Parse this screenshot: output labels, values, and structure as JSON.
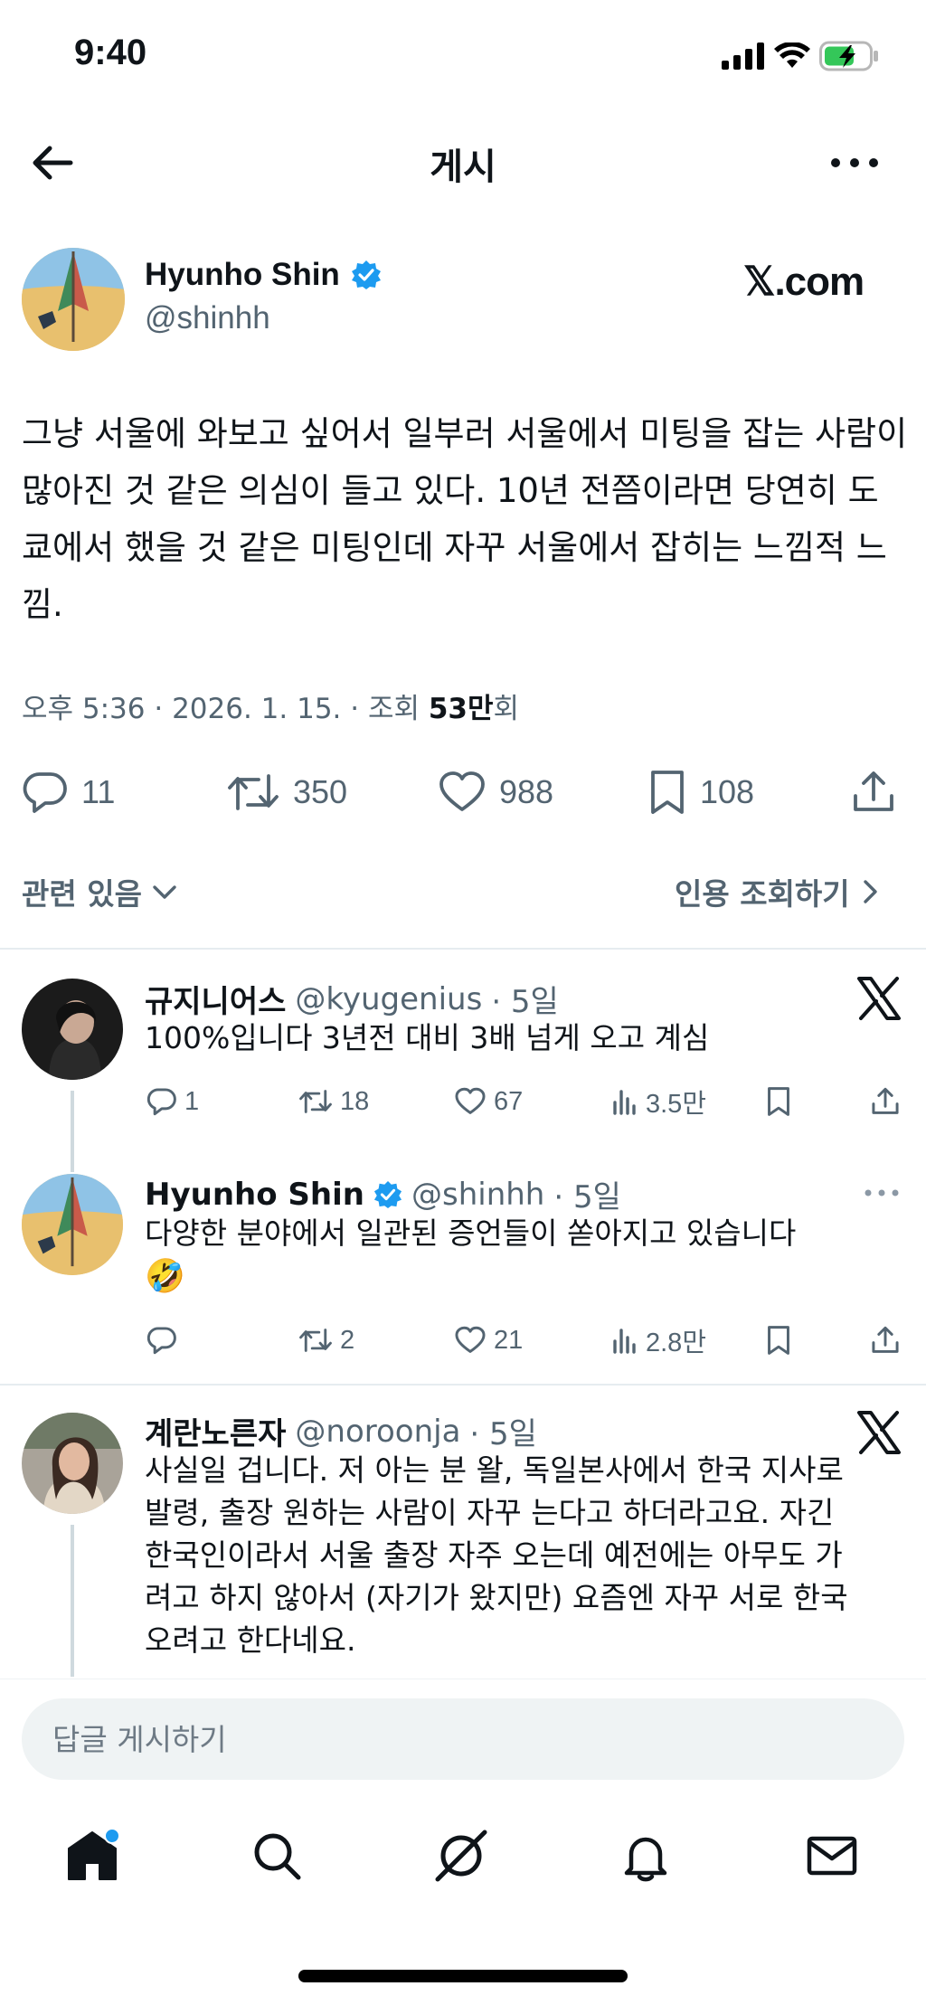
{
  "status_bar": {
    "time": "9:40"
  },
  "nav": {
    "title": "게시"
  },
  "post": {
    "author_name": "Hyunho Shin",
    "author_handle": "@shinhh",
    "site_logo": "𝕏.com",
    "body": "그냥 서울에 와보고 싶어서 일부러 서울에서 미팅을 잡는 사람이 많아진 것 같은 의심이 들고 있다. 10년 전쯤이라면 당연히 도쿄에서 했을 것 같은 미팅인데 자꾸 서울에서 잡히는 느낌적 느낌.",
    "meta_time": "오후 5:36 · 2026. 1. 15. · 조회 ",
    "meta_views": "53만",
    "meta_views_suffix": "회",
    "replies": "11",
    "retweets": "350",
    "likes": "988",
    "bookmarks": "108",
    "related_label": "관련 있음",
    "quotes_label": "인용 조회하기"
  },
  "replies": [
    {
      "name": "규지니어스",
      "handle": "@kyugenius",
      "time": "· 5일",
      "text": "100%입니다 3년전 대비 3배 넘게 오고 계심",
      "replies": "1",
      "retweets": "18",
      "likes": "67",
      "views": "3.5만"
    },
    {
      "name": "Hyunho Shin",
      "handle": "@shinhh",
      "time": "· 5일",
      "text": "다양한 분야에서 일관된 증언들이 쏟아지고 있습니다",
      "emoji": "🤣",
      "replies": "",
      "retweets": "2",
      "likes": "21",
      "views": "2.8만"
    },
    {
      "name": "계란노른자",
      "handle": "@noroonja",
      "time": "· 5일",
      "lines": [
        "사실일 겁니다. 저 아는 분 왈, 독일본사에서 한국 지사로",
        "발령, 출장 원하는 사람이 자꾸 는다고 하더라고요. 자긴",
        "한국인이라서 서울 출장 자주 오는데 예전에는 아무도 가",
        "려고 하지 않아서 (자기가 왔지만) 요즘엔 자꾸 서로 한국",
        "오려고 한다네요."
      ]
    }
  ],
  "compose": {
    "placeholder": "답글 게시하기"
  },
  "colors": {
    "verified": "#1d9bf0",
    "text": "#0f1419",
    "secondary": "#536471",
    "battery": "#34c759"
  },
  "icons": [
    "back-arrow-icon",
    "more-icon",
    "verified-badge-icon",
    "reply-icon",
    "retweet-icon",
    "heart-icon",
    "bookmark-icon",
    "share-icon",
    "views-icon",
    "x-logo-icon",
    "home-icon",
    "search-icon",
    "grok-icon",
    "bell-icon",
    "mail-icon"
  ]
}
